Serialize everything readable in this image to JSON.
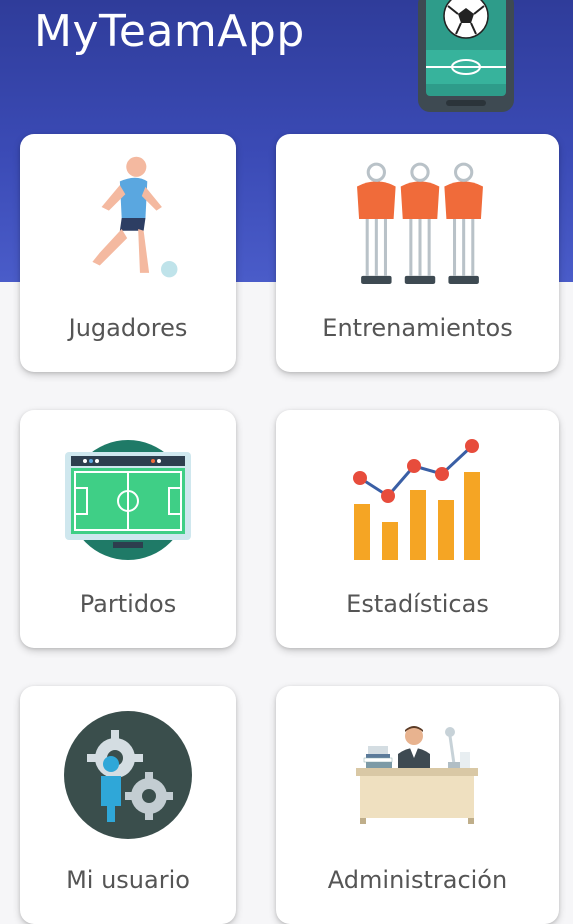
{
  "header": {
    "title": "MyTeamApp",
    "logo_icon": "phone-football-icon",
    "background_color": "#3b4bb6"
  },
  "menu": {
    "items": [
      {
        "label": "Jugadores",
        "icon": "player-kicking-ball-icon"
      },
      {
        "label": "Entrenamientos",
        "icon": "training-dummies-icon"
      },
      {
        "label": "Partidos",
        "icon": "football-field-screen-icon"
      },
      {
        "label": "Estadísticas",
        "icon": "bar-line-chart-icon"
      },
      {
        "label": "Mi usuario",
        "icon": "user-gears-icon"
      },
      {
        "label": "Administración",
        "icon": "admin-desk-icon"
      }
    ]
  },
  "colors": {
    "card_background": "#ffffff",
    "label_text": "#555555",
    "page_background": "#f6f6f8"
  }
}
